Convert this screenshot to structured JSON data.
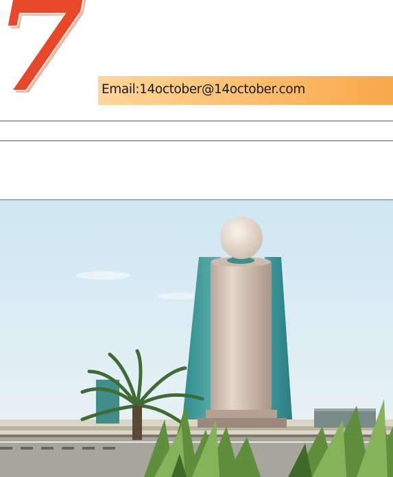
{
  "header": {
    "page_number": "7",
    "email": "Email:14october@14october.com"
  },
  "photo": {
    "subject": "tower-with-sphere-icon"
  }
}
